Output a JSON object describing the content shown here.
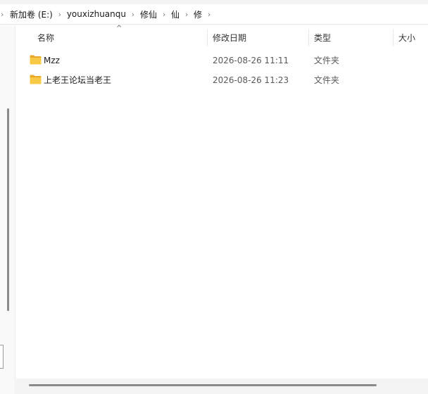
{
  "breadcrumb": {
    "items": [
      "新加卷 (E:)",
      "youxizhuanqu",
      "修仙",
      "仙",
      "修"
    ]
  },
  "columns": {
    "name": "名称",
    "date": "修改日期",
    "type": "类型",
    "size": "大小"
  },
  "files": [
    {
      "name": "Mzz",
      "date": "2026-08-26 11:11",
      "type": "文件夹"
    },
    {
      "name": "上老王论坛当老王",
      "date": "2026-08-26 11:23",
      "type": "文件夹"
    }
  ],
  "icons": {
    "folder": "folder-icon",
    "separator": "chevron-right-icon",
    "sort": "sort-ascending-icon"
  },
  "colors": {
    "folder_body": "#f8c945",
    "folder_back": "#e8a92a"
  }
}
